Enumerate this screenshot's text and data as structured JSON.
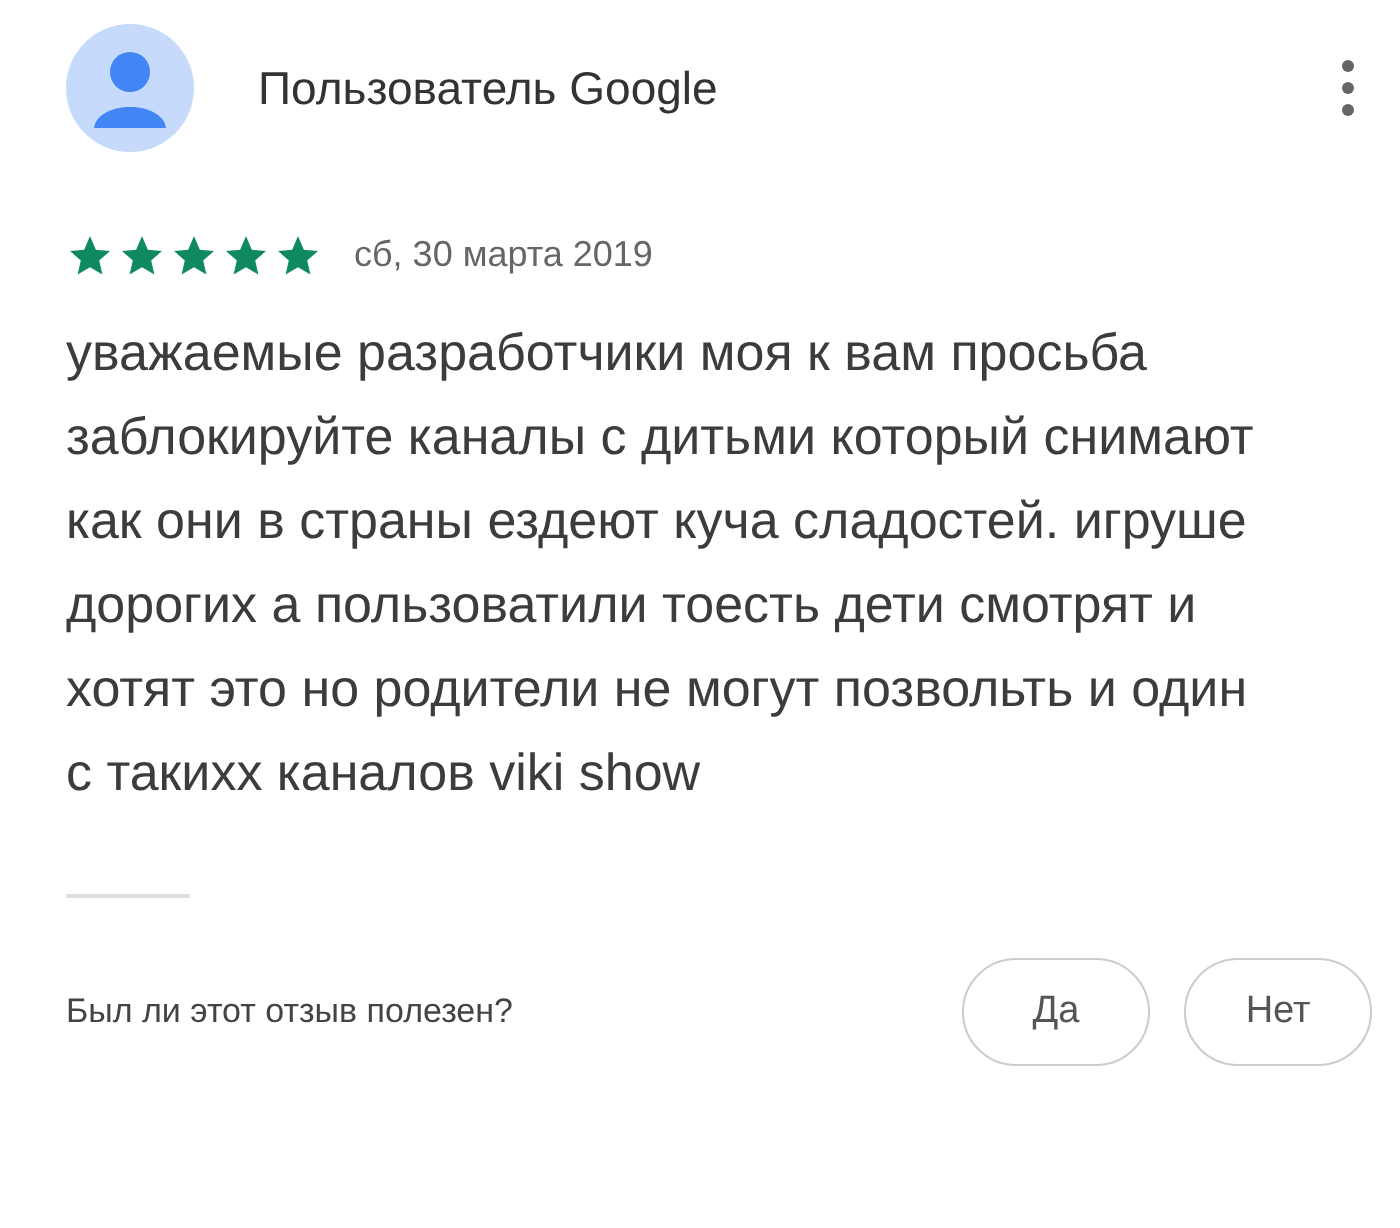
{
  "review": {
    "author": "Пользователь Google",
    "stars": 5,
    "date": "сб, 30 марта 2019",
    "text": "уважаемые разработчики моя к вам просьба заблокируйте каналы с дитьми который снимают как они в страны ездеют куча сладостей. игруше дорогих а пользоватили тоесть дети смотрят и хотят это но родители не могут позвольть и один с такихх каналов viki show"
  },
  "helpful": {
    "question": "Был ли этот отзыв полезен?",
    "buttons": [
      "Да",
      "Нет"
    ]
  }
}
